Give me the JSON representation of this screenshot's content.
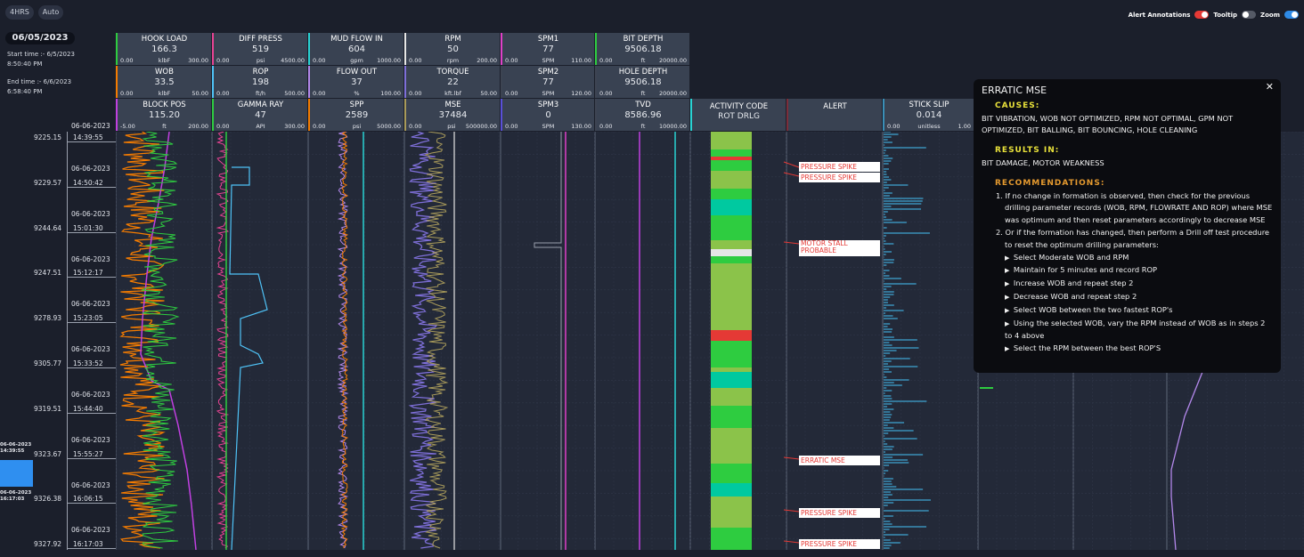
{
  "top": {
    "btn_4hrs": "4HRS",
    "btn_auto": "Auto",
    "toggles": [
      {
        "label": "Alert Annotations",
        "on": true,
        "color": "#e53935"
      },
      {
        "label": "Tooltip",
        "on": false,
        "color": "#555a66"
      },
      {
        "label": "Zoom",
        "on": true,
        "color": "#2e8ae6"
      }
    ]
  },
  "left": {
    "date": "06/05/2023",
    "start_label": "Start time :- 6/5/2023",
    "start_time": "8:50:40 PM",
    "end_label": "End time :- 6/6/2023",
    "end_time": "6:58:40 PM",
    "header_date": "06-06-2023",
    "rows": [
      {
        "depth": "9225.15",
        "time": "14:39:55",
        "date": "06-06-2023"
      },
      {
        "depth": "9229.57",
        "time": "14:50:42",
        "date": "06-06-2023"
      },
      {
        "depth": "9244.64",
        "time": "15:01:30",
        "date": "06-06-2023"
      },
      {
        "depth": "9247.51",
        "time": "15:12:17",
        "date": "06-06-2023"
      },
      {
        "depth": "9278.93",
        "time": "15:23:05",
        "date": "06-06-2023"
      },
      {
        "depth": "9305.77",
        "time": "15:33:52",
        "date": "06-06-2023"
      },
      {
        "depth": "9319.51",
        "time": "15:44:40",
        "date": "06-06-2023"
      },
      {
        "depth": "9323.67",
        "time": "15:55:27",
        "date": "06-06-2023"
      },
      {
        "depth": "9326.38",
        "time": "16:06:15",
        "date": "06-06-2023"
      },
      {
        "depth": "9327.92",
        "time": "16:17:03",
        "date": ""
      }
    ],
    "nav_top_date": "06-06-2023",
    "nav_top_time": "14:39:55",
    "nav_bot_date": "06-06-2023",
    "nav_bot_time": "16:17:03"
  },
  "headers": [
    {
      "name": "HOOK LOAD",
      "value": "166.3",
      "min": "0.00",
      "unit": "klbF",
      "max": "300.00",
      "color": "#2ecc40"
    },
    {
      "name": "DIFF PRESS",
      "value": "519",
      "min": "0.00",
      "unit": "psi",
      "max": "4500.00",
      "color": "#e84393"
    },
    {
      "name": "MUD FLOW IN",
      "value": "604",
      "min": "0.00",
      "unit": "gpm",
      "max": "1000.00",
      "color": "#29d3d3"
    },
    {
      "name": "RPM",
      "value": "50",
      "min": "0.00",
      "unit": "rpm",
      "max": "200.00",
      "color": "#e6e6e6"
    },
    {
      "name": "SPM1",
      "value": "77",
      "min": "0.00",
      "unit": "SPM",
      "max": "110.00",
      "color": "#e040c8"
    },
    {
      "name": "BIT DEPTH",
      "value": "9506.18",
      "min": "0.00",
      "unit": "ft",
      "max": "20000.00",
      "color": "#2ecc40"
    },
    {
      "name": "WOB",
      "value": "33.5",
      "min": "0.00",
      "unit": "klbF",
      "max": "50.00",
      "color": "#f57c00"
    },
    {
      "name": "ROP",
      "value": "198",
      "min": "0.00",
      "unit": "ft/h",
      "max": "500.00",
      "color": "#4fc3f7"
    },
    {
      "name": "FLOW OUT",
      "value": "37",
      "min": "0.00",
      "unit": "%",
      "max": "100.00",
      "color": "#b388eb"
    },
    {
      "name": "TORQUE",
      "value": "22",
      "min": "0.00",
      "unit": "kft.lbf",
      "max": "50.00",
      "color": "#7e6fd8"
    },
    {
      "name": "SPM2",
      "value": "77",
      "min": "0.00",
      "unit": "SPM",
      "max": "120.00",
      "color": "#3d4452"
    },
    {
      "name": "HOLE DEPTH",
      "value": "9506.18",
      "min": "0.00",
      "unit": "ft",
      "max": "20000.00",
      "color": "#3d4452"
    },
    {
      "name": "BLOCK POS",
      "value": "115.20",
      "min": "-5.00",
      "unit": "ft",
      "max": "200.00",
      "color": "#c040e0"
    },
    {
      "name": "GAMMA RAY",
      "value": "47",
      "min": "0.00",
      "unit": "API",
      "max": "300.00",
      "color": "#2ecc40"
    },
    {
      "name": "SPP",
      "value": "2589",
      "min": "0.00",
      "unit": "psi",
      "max": "5000.00",
      "color": "#f57c00"
    },
    {
      "name": "MSE",
      "value": "37484",
      "min": "0.00",
      "unit": "psi",
      "max": "500000.00",
      "color": "#a89a5a"
    },
    {
      "name": "SPM3",
      "value": "0",
      "min": "0.00",
      "unit": "SPM",
      "max": "130.00",
      "color": "#5a4fd8"
    },
    {
      "name": "TVD",
      "value": "8586.96",
      "min": "0.00",
      "unit": "ft",
      "max": "10000.00",
      "color": "#3d4452"
    }
  ],
  "activity": {
    "name": "ACTIVITY CODE",
    "value": "ROT DRLG",
    "color": "#29d3d3"
  },
  "alert_col": {
    "name": "ALERT",
    "color": "#7b2d3a"
  },
  "stick": {
    "name": "STICK SLIP",
    "value": "0.014",
    "min": "0.00",
    "unit": "unitless",
    "max": "1.00",
    "color": "#3a8fb7"
  },
  "alerts": [
    "PRESSURE SPIKE",
    "PRESSURE SPIKE",
    "MOTOR STALL PROBABLE",
    "ERRATIC MSE",
    "PRESSURE SPIKE",
    "PRESSURE SPIKE"
  ],
  "popup": {
    "title": "ERRATIC MSE",
    "causes_label": "CAUSES:",
    "causes": "BIT VIBRATION, WOB NOT OPTIMIZED, RPM NOT OPTIMAL, GPM NOT OPTIMIZED, BIT BALLING, BIT BOUNCING, HOLE CLEANING",
    "results_label": "RESULTS IN:",
    "results": "BIT DAMAGE, MOTOR WEAKNESS",
    "rec_label": "RECOMMENDATIONS:",
    "rec1": "1. If no change in formation is observed, then check for the previous drilling parameter records (WOB, RPM, FLOWRATE AND ROP) where MSE was optimum and then reset parameters accordingly to decrease MSE",
    "rec2": "2. Or if the formation has changed, then perform a Drill off test procedure to reset the optimum drilling parameters:",
    "steps": [
      "Select Moderate WOB and RPM",
      "Maintain for 5 minutes and record ROP",
      "Increase WOB and repeat step 2",
      "Decrease WOB and repeat step 2",
      "Select WOB between the two fastest ROP's",
      "Using the selected WOB, vary the RPM instead of WOB as in steps 2 to 4 above",
      "Select the RPM between the best ROP'S"
    ]
  }
}
